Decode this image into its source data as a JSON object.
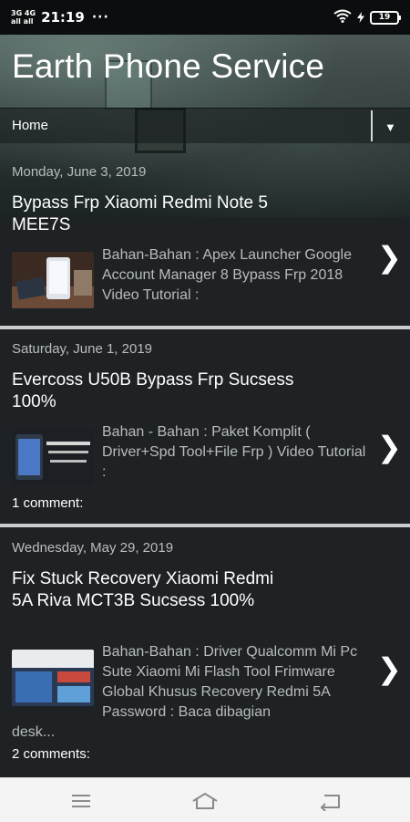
{
  "status_bar": {
    "signal_top": "3G 4G",
    "signal_bottom": "all all",
    "time": "21:19",
    "dots": "···",
    "battery": "19"
  },
  "header": {
    "title": "Earth Phone Service",
    "nav_home": "Home"
  },
  "posts": [
    {
      "date": "Monday, June 3, 2019",
      "title": "Bypass Frp Xiaomi Redmi Note 5 MEE7S",
      "snippet": "Bahan-Bahan : Apex Launcher Google Account Manager 8 Bypass Frp 2018 Video Tutorial :",
      "comments": ""
    },
    {
      "date": "Saturday, June 1, 2019",
      "title": "Evercoss U50B Bypass Frp Sucsess 100%",
      "snippet": "Bahan - Bahan : Paket Komplit ( Driver+Spd Tool+File Frp ) Video Tutorial :",
      "comments": "1 comment:"
    },
    {
      "date": "Wednesday, May 29, 2019",
      "title": "Fix Stuck Recovery Xiaomi Redmi 5A Riva MCT3B Sucsess 100%",
      "snippet": "Bahan-Bahan : Driver Qualcomm Mi Pc Sute Xiaomi Mi Flash Tool Frimware Global Khusus Recovery Redmi 5A Password : Baca dibagian",
      "snippet_cont": "desk...",
      "comments": "2 comments:"
    }
  ],
  "colors": {
    "background": "#1e2224",
    "separator": "#c9cdcf",
    "muted_text": "#b8bcbd"
  },
  "icons": {
    "chevron": "chevron-right-icon",
    "menu": "menu-icon",
    "home": "home-icon",
    "back": "back-icon"
  }
}
